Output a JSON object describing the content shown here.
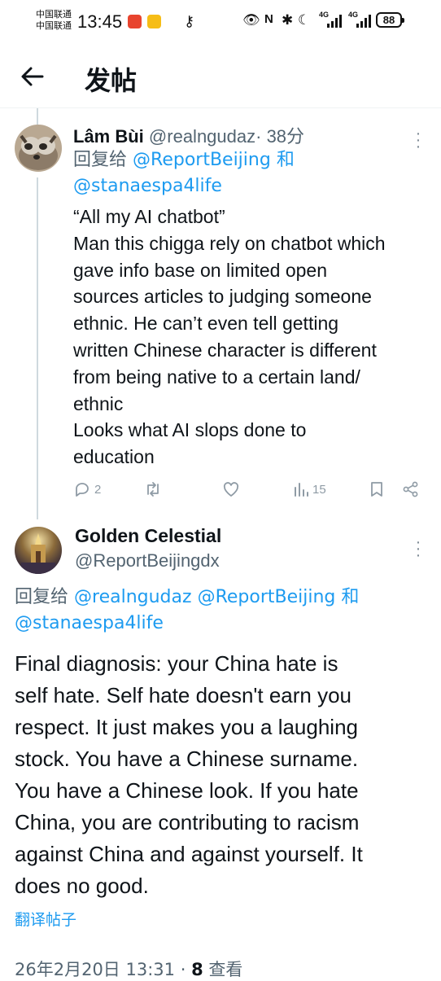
{
  "status_bar": {
    "carrier_1": "中国联通",
    "carrier_2": "中国联通",
    "time": "13:45",
    "net_1": "4G",
    "net_2": "4G",
    "battery": "88"
  },
  "header": {
    "title": "发帖"
  },
  "reply_tweet": {
    "name": "Lâm Bùi",
    "handle": "@realngudaz",
    "time": "· 38分",
    "reply_prefix": "回复给",
    "reply_to_1": "@ReportBeijing",
    "reply_and": "和",
    "reply_to_2": "@stanaespa4life",
    "body_lines": [
      "“All my AI chatbot”",
      "Man this chigga rely on chatbot which",
      "gave info base on limited open",
      "sources articles to judging someone",
      "ethnic. He can’t even tell getting",
      "written Chinese character is different",
      "from being native to a certain land/",
      "ethnic",
      "Looks what AI slops done to",
      "education"
    ],
    "actions": {
      "replies": "2",
      "views": "15"
    }
  },
  "main_tweet": {
    "name": "Golden Celestial",
    "handle": "@ReportBeijingdx",
    "reply_prefix": "回复给",
    "reply_to_1": "@realngudaz",
    "reply_to_2": "@ReportBeijing",
    "reply_and": "和",
    "reply_to_3": "@stanaespa4life",
    "body_lines": [
      "Final diagnosis: your China hate is",
      "self hate. Self hate doesn't earn you",
      "respect. It just makes you a laughing",
      "stock. You have a Chinese surname.",
      "You have a Chinese look. If you hate",
      "China, you are contributing to racism",
      "against China and against yourself. It",
      "does no good."
    ],
    "translate_label": "翻译帖子",
    "date": "26年2月20日",
    "clock": "13:31",
    "views_count": "8",
    "views_label": "查看"
  },
  "colors": {
    "link": "#1d9bf0",
    "muted": "#536471",
    "text": "#0f1419"
  }
}
